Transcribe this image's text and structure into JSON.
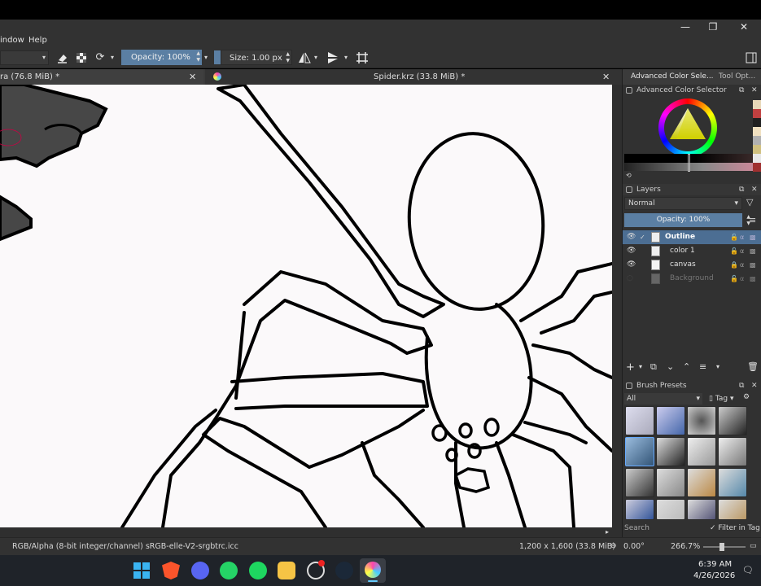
{
  "window": {
    "minimize": "—",
    "restore": "❐",
    "close": "✕"
  },
  "menu": {
    "window": "indow",
    "help": "Help"
  },
  "toolbar": {
    "opacity": "Opacity: 100%",
    "size": "Size: 1.00 px"
  },
  "tabs": [
    {
      "label": "ra (76.8 MiB) *",
      "close": "✕"
    },
    {
      "label": "Spider.krz (33.8 MiB) *",
      "close": "✕"
    }
  ],
  "dock": {
    "tabs": [
      "Advanced Color Sele...",
      "Tool Opt..."
    ],
    "color_selector": {
      "title": "Advanced Color Selector"
    },
    "layers": {
      "title": "Layers",
      "blend_mode": "Normal",
      "opacity": "Opacity: 100%",
      "items": [
        {
          "name": "Outline",
          "active": true
        },
        {
          "name": "color 1",
          "active": false
        },
        {
          "name": "canvas",
          "active": false
        },
        {
          "name": "Background",
          "active": false
        }
      ]
    },
    "brush_presets": {
      "title": "Brush Presets",
      "filter": "All",
      "tag": "Tag",
      "search_placeholder": "Search",
      "filter_in_tag": "Filter in Tag"
    }
  },
  "status": {
    "color_space": "RGB/Alpha (8-bit integer/channel)  sRGB-elle-V2-srgbtrc.icc",
    "dimensions": "1,200 x 1,600 (33.8 MiB)",
    "rotation": "0.00°",
    "zoom": "266.7%"
  },
  "taskbar": {
    "time": "6:39 AM",
    "date": "4/26/2026"
  },
  "colors": {
    "accent": "#5b7fa3",
    "selected_layer": "#4c6e93"
  }
}
